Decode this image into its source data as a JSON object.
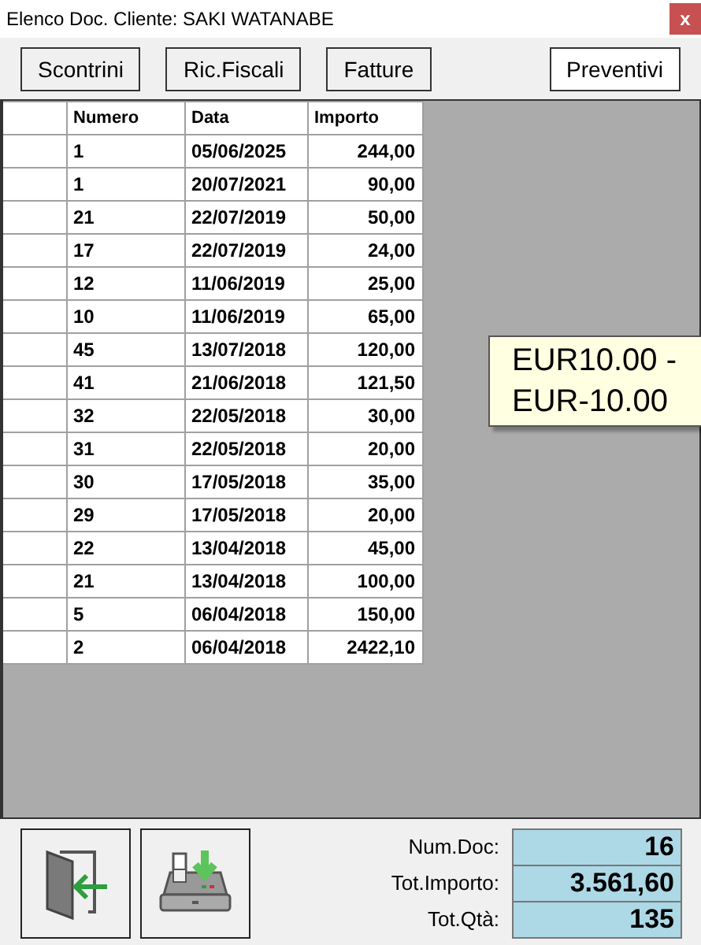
{
  "window": {
    "title": "Elenco Doc. Cliente: SAKI WATANABE",
    "close": "x"
  },
  "doc_buttons": [
    "Scontrini",
    "Ric.Fiscali",
    "Fatture",
    "Preventivi"
  ],
  "table": {
    "columns": [
      "Numero",
      "Data",
      "Importo"
    ],
    "rows": [
      [
        "1",
        "05/06/2025",
        "244,00"
      ],
      [
        "1",
        "20/07/2021",
        "90,00"
      ],
      [
        "21",
        "22/07/2019",
        "50,00"
      ],
      [
        "17",
        "22/07/2019",
        "24,00"
      ],
      [
        "12",
        "11/06/2019",
        "25,00"
      ],
      [
        "10",
        "11/06/2019",
        "65,00"
      ],
      [
        "45",
        "13/07/2018",
        "120,00"
      ],
      [
        "41",
        "21/06/2018",
        "121,50"
      ],
      [
        "32",
        "22/05/2018",
        "30,00"
      ],
      [
        "31",
        "22/05/2018",
        "20,00"
      ],
      [
        "30",
        "17/05/2018",
        "35,00"
      ],
      [
        "29",
        "17/05/2018",
        "20,00"
      ],
      [
        "22",
        "13/04/2018",
        "45,00"
      ],
      [
        "21",
        "13/04/2018",
        "100,00"
      ],
      [
        "5",
        "06/04/2018",
        "150,00"
      ],
      [
        "2",
        "06/04/2018",
        "2422,10"
      ]
    ]
  },
  "tooltip": {
    "lines": [
      "EUR10.00 -",
      "EUR-10.00"
    ]
  },
  "totals": [
    {
      "label": "Num.Doc:",
      "value": "16"
    },
    {
      "label": "Tot.Importo:",
      "value": "3.561,60"
    },
    {
      "label": "Tot.Qtà:",
      "value": "135"
    }
  ]
}
